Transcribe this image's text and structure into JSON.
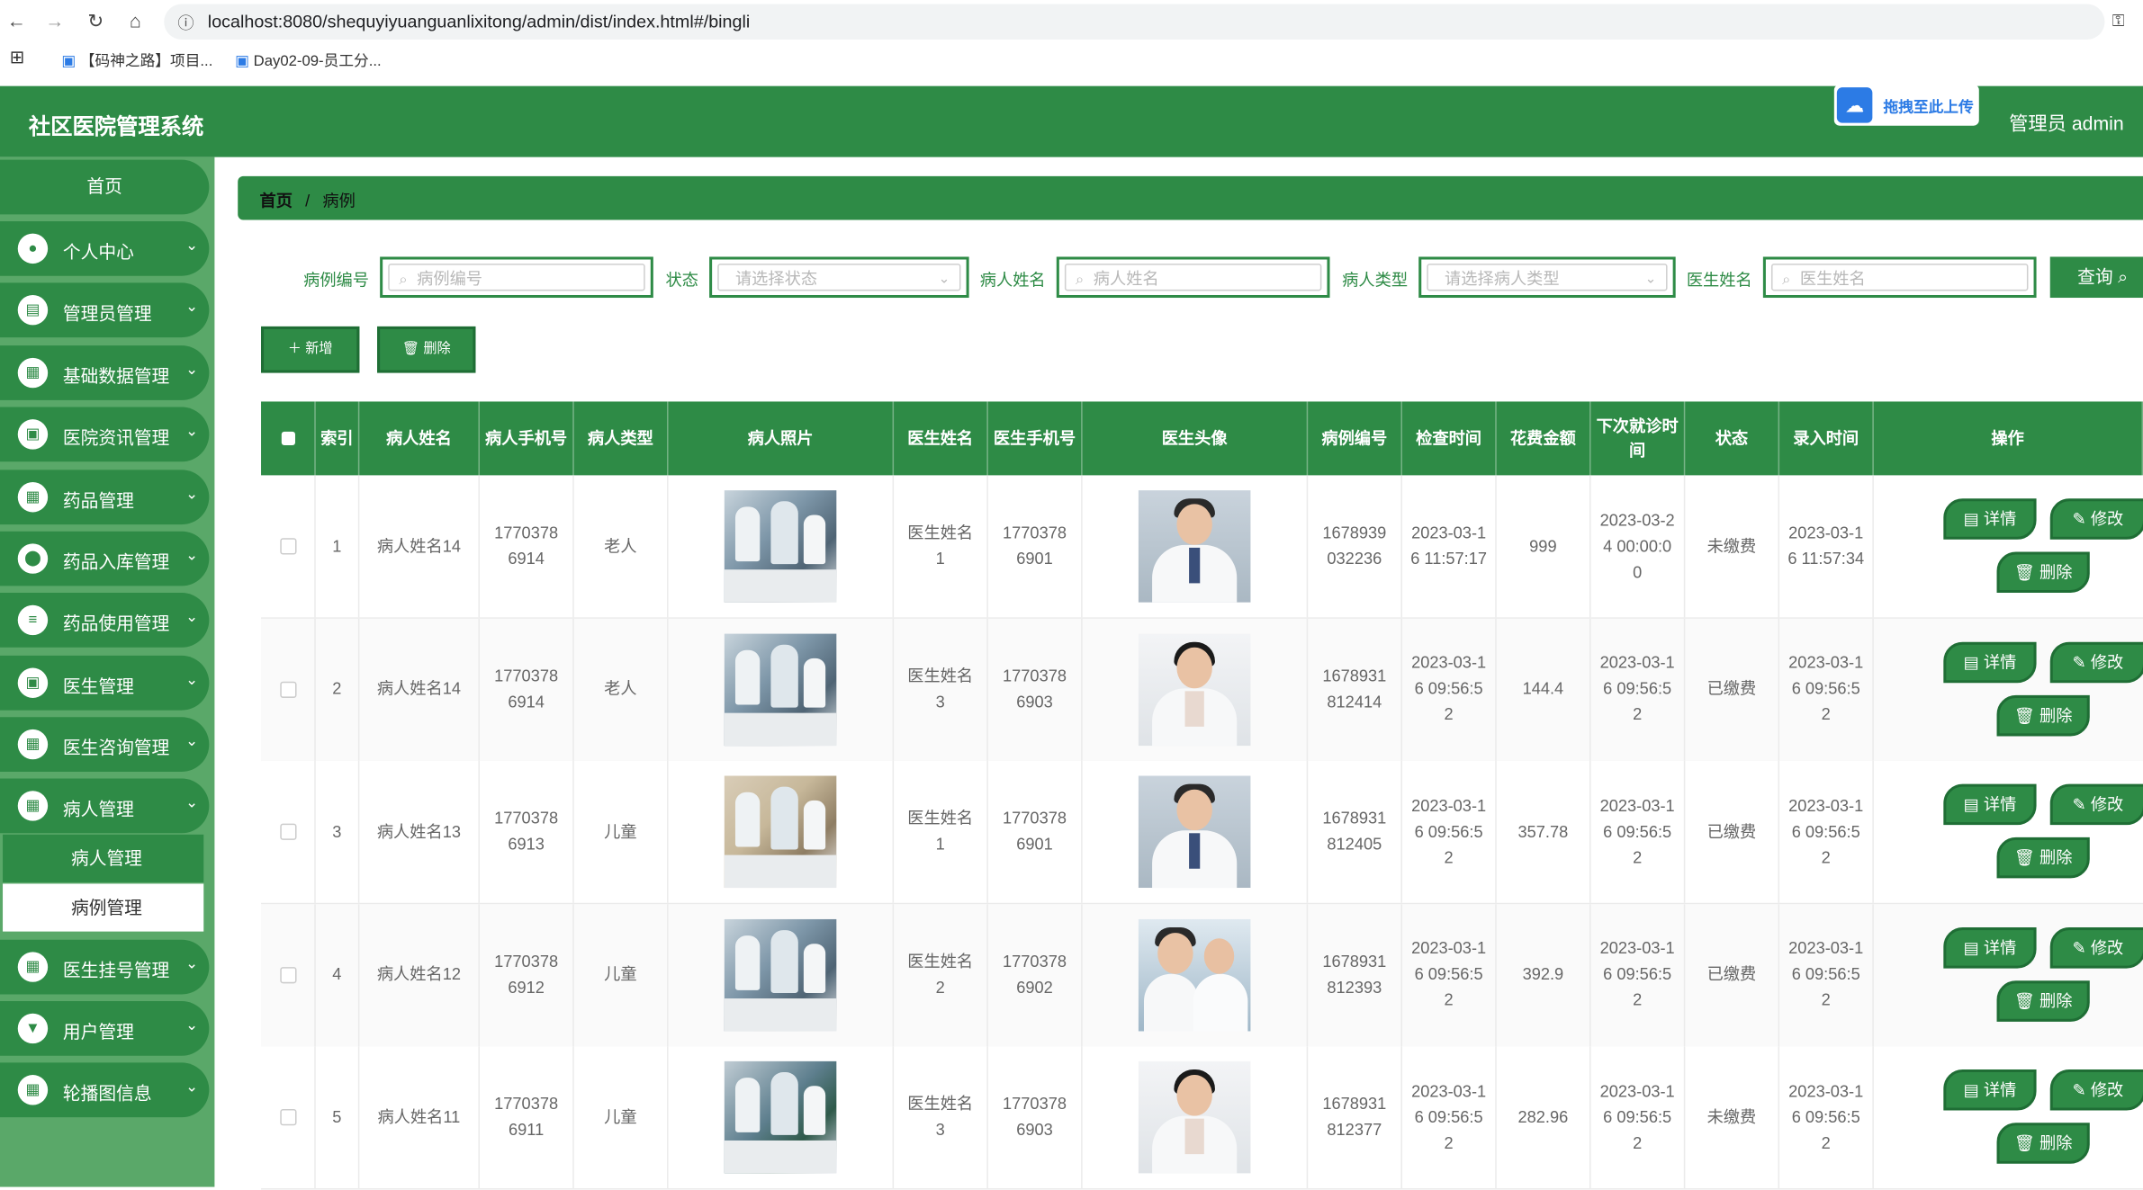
{
  "browser": {
    "url": "localhost:8080/shequyiyuanguanlixitong/admin/dist/index.html#/bingli",
    "bookmarks": [
      "【码神之路】项目...",
      "Day02-09-员工分..."
    ]
  },
  "header": {
    "title": "社区医院管理系统",
    "upload_label": "拖拽至此上传",
    "user": "管理员 admin"
  },
  "sidebar": {
    "home": "首页",
    "items": [
      {
        "label": "个人中心",
        "icon": "user-icon"
      },
      {
        "label": "管理员管理",
        "icon": "clipboard-icon"
      },
      {
        "label": "基础数据管理",
        "icon": "grid-icon"
      },
      {
        "label": "医院资讯管理",
        "icon": "briefcase-icon"
      },
      {
        "label": "药品管理",
        "icon": "grid-icon"
      },
      {
        "label": "药品入库管理",
        "icon": "location-icon"
      },
      {
        "label": "药品使用管理",
        "icon": "list-icon"
      },
      {
        "label": "医生管理",
        "icon": "briefcase-icon"
      },
      {
        "label": "医生咨询管理",
        "icon": "grid-icon"
      },
      {
        "label": "病人管理",
        "icon": "grid-icon"
      },
      {
        "label": "医生挂号管理",
        "icon": "grid-icon"
      },
      {
        "label": "用户管理",
        "icon": "cup-icon"
      },
      {
        "label": "轮播图信息",
        "icon": "grid-icon"
      }
    ],
    "subitems": [
      "病人管理",
      "病例管理"
    ]
  },
  "breadcrumb": {
    "home": "首页",
    "sep": "/",
    "current": "病例"
  },
  "search": {
    "fields": [
      {
        "label": "病例编号",
        "placeholder": "病例编号"
      },
      {
        "label": "状态",
        "placeholder": "请选择状态"
      },
      {
        "label": "病人姓名",
        "placeholder": "病人姓名"
      },
      {
        "label": "病人类型",
        "placeholder": "请选择病人类型"
      },
      {
        "label": "医生姓名",
        "placeholder": "医生姓名"
      }
    ],
    "query": "查询"
  },
  "actions": {
    "add": "新增",
    "delete": "删除"
  },
  "table": {
    "headers": [
      "索引",
      "病人姓名",
      "病人手机号",
      "病人类型",
      "病人照片",
      "医生姓名",
      "医生手机号",
      "医生头像",
      "病例编号",
      "检查时间",
      "花费金额",
      "下次就诊时间",
      "状态",
      "录入时间",
      "操作"
    ],
    "rows": [
      {
        "idx": "1",
        "name": "病人姓名14",
        "phone": "17703786914",
        "type": "老人",
        "doctor": "医生姓名1",
        "dphone": "17703786901",
        "case": "1678939032236",
        "check": "2023-03-16 11:57:17",
        "cost": "999",
        "next": "2023-03-24 00:00:00",
        "status": "未缴费",
        "created": "2023-03-16 11:57:34"
      },
      {
        "idx": "2",
        "name": "病人姓名14",
        "phone": "17703786914",
        "type": "老人",
        "doctor": "医生姓名3",
        "dphone": "17703786903",
        "case": "1678931812414",
        "check": "2023-03-16 09:56:52",
        "cost": "144.4",
        "next": "2023-03-16 09:56:52",
        "status": "已缴费",
        "created": "2023-03-16 09:56:52"
      },
      {
        "idx": "3",
        "name": "病人姓名13",
        "phone": "17703786913",
        "type": "儿童",
        "doctor": "医生姓名1",
        "dphone": "17703786901",
        "case": "1678931812405",
        "check": "2023-03-16 09:56:52",
        "cost": "357.78",
        "next": "2023-03-16 09:56:52",
        "status": "已缴费",
        "created": "2023-03-16 09:56:52"
      },
      {
        "idx": "4",
        "name": "病人姓名12",
        "phone": "17703786912",
        "type": "儿童",
        "doctor": "医生姓名2",
        "dphone": "17703786902",
        "case": "1678931812393",
        "check": "2023-03-16 09:56:52",
        "cost": "392.9",
        "next": "2023-03-16 09:56:52",
        "status": "已缴费",
        "created": "2023-03-16 09:56:52"
      },
      {
        "idx": "5",
        "name": "病人姓名11",
        "phone": "17703786911",
        "type": "儿童",
        "doctor": "医生姓名3",
        "dphone": "17703786903",
        "case": "1678931812377",
        "check": "2023-03-16 09:56:52",
        "cost": "282.96",
        "next": "2023-03-16 09:56:52",
        "status": "未缴费",
        "created": "2023-03-16 09:56:52"
      }
    ],
    "row_actions": {
      "detail": "详情",
      "edit": "修改",
      "delete": "删除"
    }
  }
}
